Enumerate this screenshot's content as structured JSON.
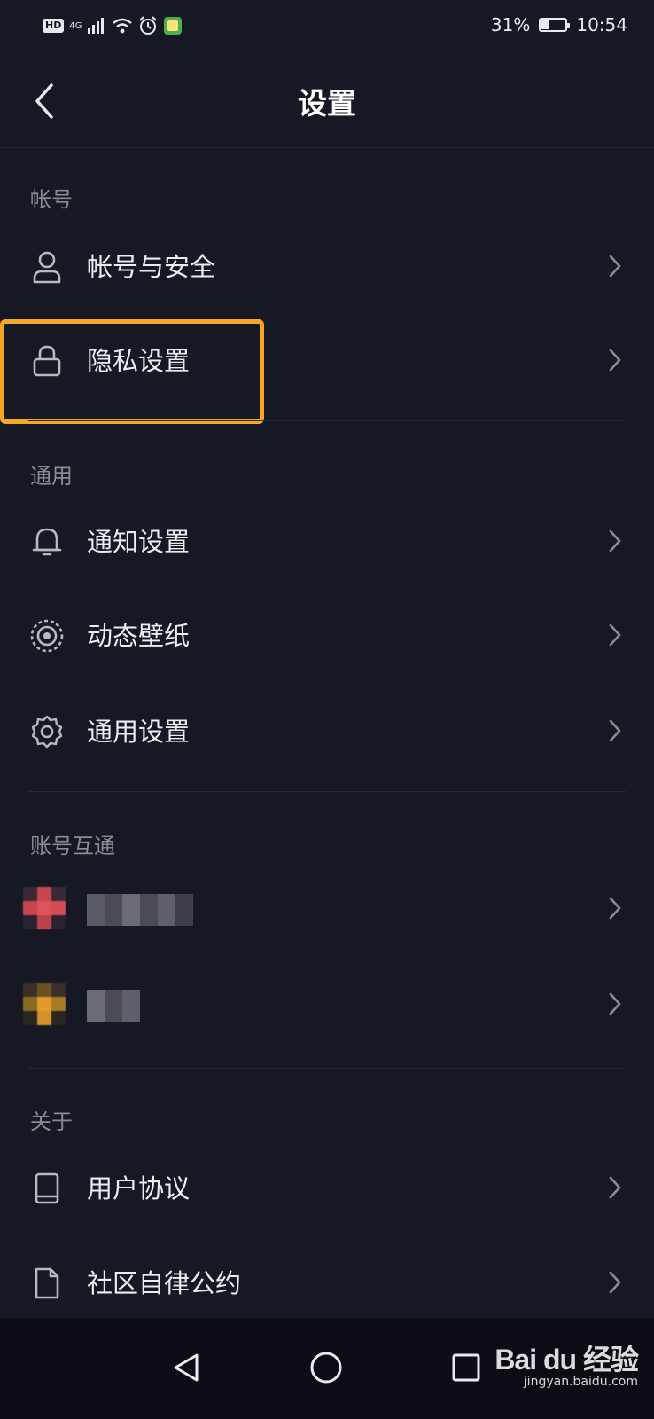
{
  "status_bar": {
    "hd": "HD",
    "network": "4G",
    "battery_percent": "31%",
    "battery_level": 0.31,
    "time": "10:54"
  },
  "header": {
    "title": "设置",
    "back_icon": "chevron-left-icon"
  },
  "sections": [
    {
      "header": "帐号",
      "items": [
        {
          "label": "帐号与安全",
          "icon": "person-icon"
        },
        {
          "label": "隐私设置",
          "icon": "lock-icon"
        }
      ]
    },
    {
      "header": "通用",
      "items": [
        {
          "label": "通知设置",
          "icon": "bell-icon"
        },
        {
          "label": "动态壁纸",
          "icon": "wallpaper-icon"
        },
        {
          "label": "通用设置",
          "icon": "gear-icon"
        }
      ]
    },
    {
      "header": "账号互通",
      "items": [
        {
          "label": "",
          "icon": "linked-app-avatar",
          "blurred": true
        },
        {
          "label": "",
          "icon": "linked-app-avatar",
          "blurred": true
        }
      ]
    },
    {
      "header": "关于",
      "items": [
        {
          "label": "用户协议",
          "icon": "book-icon"
        },
        {
          "label": "社区自律公约",
          "icon": "document-icon"
        }
      ]
    }
  ],
  "highlight_color": "#f5a623",
  "system_nav": {
    "back": "triangle-back-icon",
    "home": "circle-home-icon",
    "recents": "square-recents-icon"
  },
  "watermark": {
    "logo": "Bai du 经验",
    "url": "jingyan.baidu.com"
  }
}
